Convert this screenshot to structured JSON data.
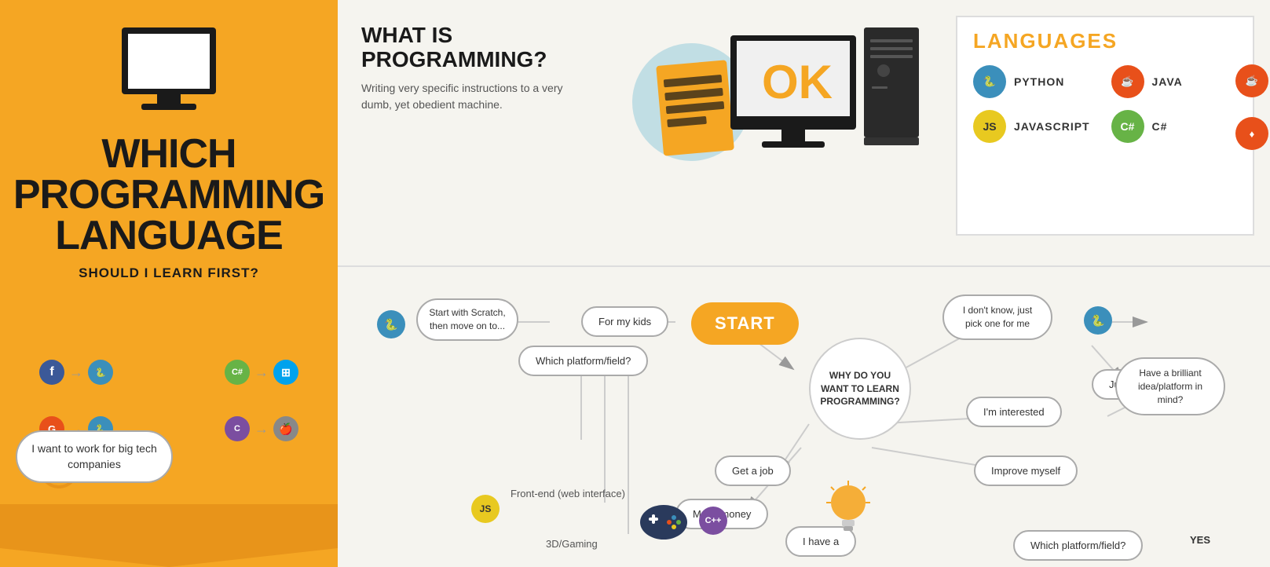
{
  "banner": {
    "title": "WHICH\nPROGRAMMING\nLANGUAGE",
    "subtitle": "SHOULD I LEARN FIRST?",
    "title_line1": "WHICH",
    "title_line2": "PROGRAMMING",
    "title_line3": "LANGUAGE"
  },
  "what_is_programming": {
    "title": "WHAT IS\nPROGRAMMING?",
    "title_line1": "WHAT IS",
    "title_line2": "PROGRAMMING?",
    "description": "Writing very specific instructions to a very dumb, yet obedient machine."
  },
  "languages": {
    "title": "LANGUAGES",
    "items": [
      {
        "name": "PYTHON",
        "color": "#3b8fbb",
        "symbol": "🐍"
      },
      {
        "name": "JAVA",
        "color": "#e8501a",
        "symbol": "☕"
      },
      {
        "name": "JAVASCRIPT",
        "color": "#e8c920",
        "symbol": "JS"
      },
      {
        "name": "C#",
        "color": "#67b346",
        "symbol": "C#"
      }
    ]
  },
  "flowchart": {
    "start_label": "START",
    "center_question": "WHY DO YOU\nWANT TO LEARN\nPROGRAMMING?",
    "nodes": {
      "for_my_kids": "For my kids",
      "start_with_scratch": "Start with Scratch,\nthen move on to...",
      "get_a_job": "Get a job",
      "make_money": "Make money",
      "i_have": "I have a",
      "which_platform": "Which platform/field?",
      "which_platform2": "Which platform/field?",
      "i_dont_know": "I don't know, just\npick one for me",
      "just_for_fun": "Just for fun",
      "im_interested": "I'm interested",
      "improve_myself": "Improve myself",
      "have_brilliant_idea": "Have a brilliant\nidea/platform\nin mind?",
      "yes_label": "YES",
      "front_end": "Front-end\n(web interface)",
      "gaming_3d": "3D/Gaming",
      "i_want_big_tech": "I want to work for\nbig tech companies"
    }
  },
  "icons": {
    "python_color": "#3b8fbb",
    "java_color": "#e8501a",
    "javascript_color": "#e8c920",
    "csharp_color": "#67b346",
    "facebook_color": "#3b5998",
    "google_color": "#e8501a",
    "cplusplus_color": "#7b4ea0",
    "windows_color": "#00a2ed",
    "apple_color": "#888888"
  }
}
